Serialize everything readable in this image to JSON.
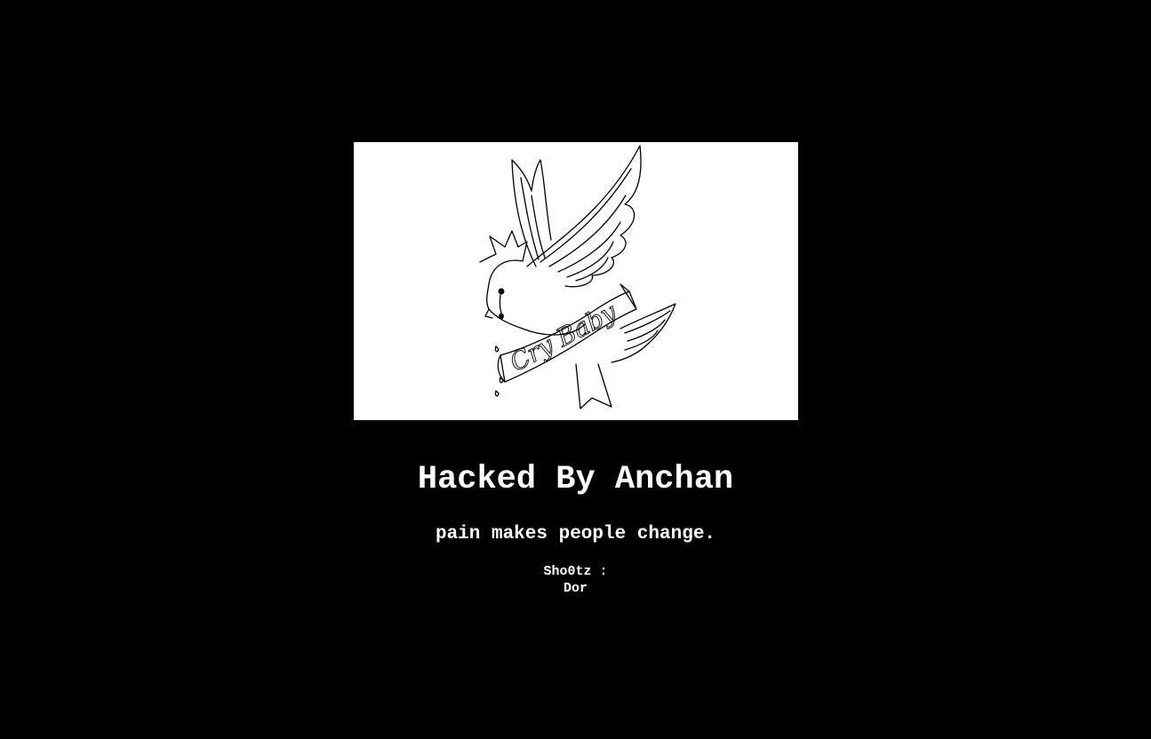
{
  "hero": {
    "illustration": "crying-bird-with-banner",
    "banner_text": "Cry Baby",
    "background_color": "#ffffff",
    "line_color": "#000000"
  },
  "headline": "Hacked By Anchan",
  "tagline": "pain makes people change.",
  "shoutz": {
    "label": "Sho0tz :",
    "names": "Dor"
  },
  "colors": {
    "page_background": "#000000",
    "text": "#ffffff"
  }
}
